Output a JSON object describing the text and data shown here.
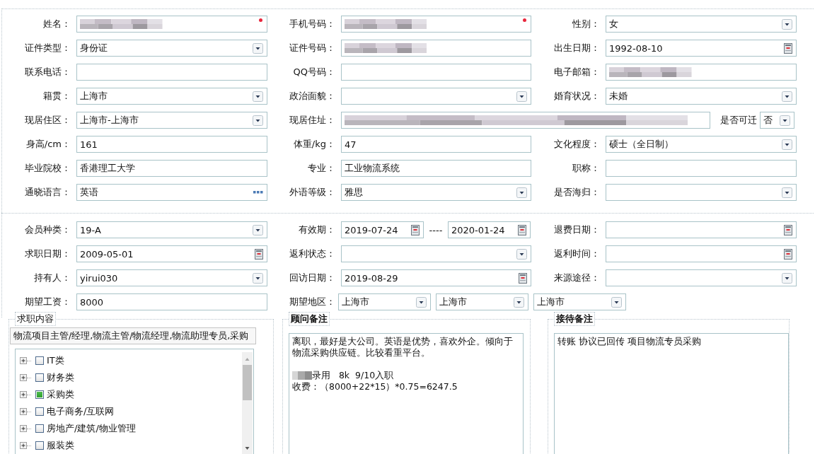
{
  "sections": [
    {
      "fields": [
        {
          "label": "姓名：",
          "kind": "text",
          "blurred": true,
          "required": true
        },
        {
          "label": "手机号码：",
          "kind": "text",
          "blurred": true,
          "required": true
        },
        {
          "label": "性别：",
          "kind": "select",
          "value": "女"
        },
        {
          "label": "证件类型：",
          "kind": "select",
          "value": "身份证"
        },
        {
          "label": "证件号码：",
          "kind": "text",
          "blurred": true
        },
        {
          "label": "出生日期：",
          "kind": "date",
          "value": "1992-08-10"
        },
        {
          "label": "联系电话：",
          "kind": "text"
        },
        {
          "label": "QQ号码：",
          "kind": "text"
        },
        {
          "label": "电子邮箱：",
          "kind": "text",
          "blurred": true
        },
        {
          "label": "籍贯：",
          "kind": "select",
          "value": "上海市"
        },
        {
          "label": "政治面貌：",
          "kind": "select"
        },
        {
          "label": "婚育状况：",
          "kind": "select",
          "value": "未婚"
        },
        {
          "label": "现居住区：",
          "kind": "select",
          "value": "上海市-上海市"
        },
        {
          "label": "现居住址：",
          "kind": "address",
          "blurred": true,
          "option": {
            "label": "是否可迁",
            "value": "否"
          }
        },
        {
          "label": "身高/cm：",
          "kind": "text",
          "value": "161"
        },
        {
          "label": "体重/kg：",
          "kind": "text",
          "value": "47"
        },
        {
          "label": "文化程度：",
          "kind": "select",
          "value": "硕士（全日制）"
        },
        {
          "label": "毕业院校：",
          "kind": "text",
          "value": "香港理工大学"
        },
        {
          "label": "专业：",
          "kind": "text",
          "value": "工业物流系统"
        },
        {
          "label": "职称：",
          "kind": "text"
        },
        {
          "label": "通晓语言：",
          "kind": "lookup",
          "value": "英语"
        },
        {
          "label": "外语等级：",
          "kind": "select",
          "value": "雅思"
        },
        {
          "label": "是否海归：",
          "kind": "select"
        }
      ]
    },
    {
      "fields": [
        {
          "label": "会员种类：",
          "kind": "select",
          "value": "19-A"
        },
        {
          "label": "有效期：",
          "kind": "date_range",
          "values": [
            "2019-07-24",
            "2020-01-24"
          ],
          "separator": "----"
        },
        {
          "label": "退费日期：",
          "kind": "date"
        },
        {
          "label": "求职日期：",
          "kind": "date",
          "value": "2009-05-01"
        },
        {
          "label": "返利状态：",
          "kind": "select"
        },
        {
          "label": "返利时间：",
          "kind": "date"
        },
        {
          "label": "持有人：",
          "kind": "select",
          "value": "yirui030"
        },
        {
          "label": "回访日期：",
          "kind": "date",
          "value": "2019-08-29"
        },
        {
          "label": "来源途径：",
          "kind": "select"
        },
        {
          "label": "期望工资：",
          "kind": "text",
          "value": "8000"
        },
        {
          "label": "期望地区：",
          "kind": "multi_select",
          "values": [
            "上海市",
            "上海市",
            "上海市"
          ]
        }
      ]
    }
  ],
  "job_panel": {
    "title": "求职内容",
    "summary": "物流项目主管/经理,物流主管/物流经理,物流助理专员,采购",
    "tree": [
      {
        "label": "IT类",
        "checked": false,
        "expanded": false
      },
      {
        "label": "财务类",
        "checked": false,
        "expanded": false
      },
      {
        "label": "采购类",
        "checked": true,
        "expanded": false
      },
      {
        "label": "电子商务/互联网",
        "checked": false,
        "expanded": false
      },
      {
        "label": "房地产/建筑/物业管理",
        "checked": false,
        "expanded": false
      },
      {
        "label": "服装类",
        "checked": false,
        "expanded": false
      }
    ]
  },
  "note_panels": [
    {
      "title": "顾问备注",
      "paragraphs": [
        {
          "lines": [
            {
              "text": "离职，最好是大公司。英语是优势，喜欢外企。倾向于物流采购供应链。比较看重平台。",
              "blurred_prefix": false
            }
          ]
        },
        {
          "lines": [
            {
              "text": "录用   8k  9/10入职",
              "blurred_prefix": true
            },
            {
              "text": "收费：（8000+22*15）*0.75=6247.5",
              "blurred_prefix": false
            }
          ]
        }
      ]
    },
    {
      "title": "接待备注",
      "paragraphs": [
        {
          "lines": [
            {
              "text": "转账 协议已回传 项目物流专员采购",
              "blurred_prefix": false
            }
          ]
        }
      ]
    }
  ]
}
